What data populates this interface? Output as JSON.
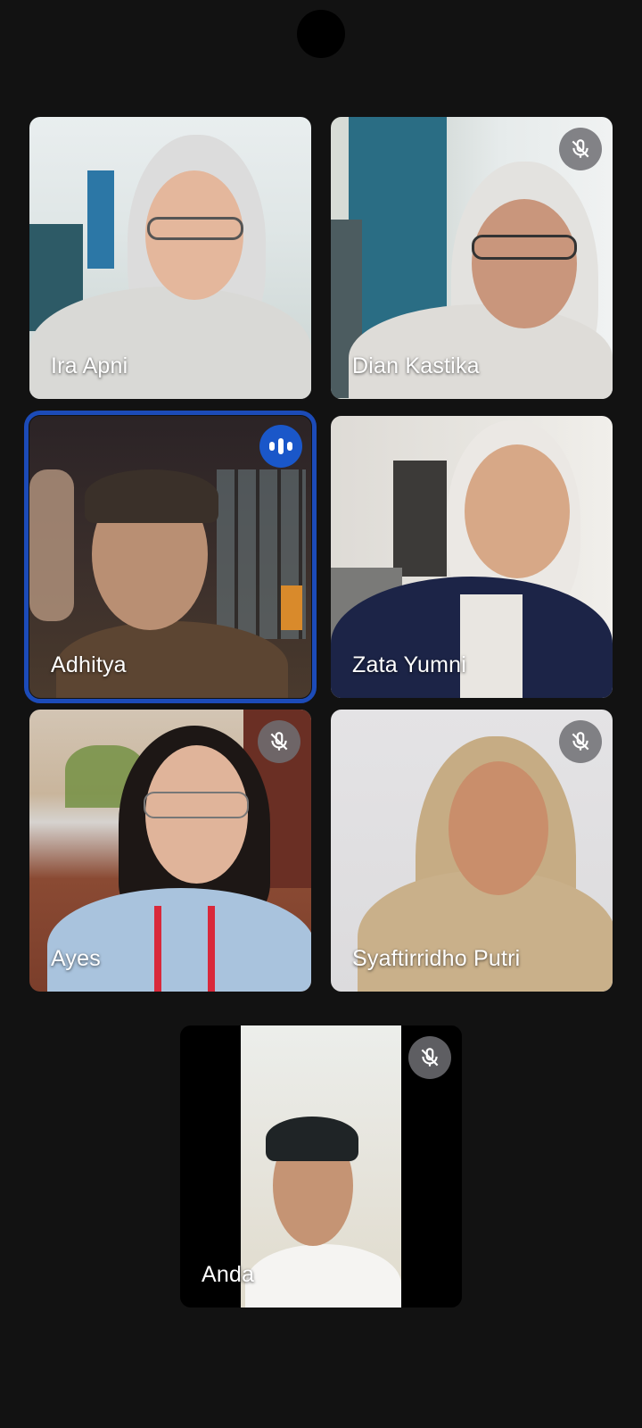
{
  "participants": [
    {
      "name": "Ira Apni",
      "muted": false,
      "speaking": false
    },
    {
      "name": "Dian Kastika",
      "muted": true,
      "speaking": false
    },
    {
      "name": "Adhitya",
      "muted": false,
      "speaking": true
    },
    {
      "name": "Zata Yumni",
      "muted": false,
      "speaking": false
    },
    {
      "name": "Ayes",
      "muted": true,
      "speaking": false
    },
    {
      "name": "Syaftirridho Putri",
      "muted": true,
      "speaking": false
    },
    {
      "name": "Anda",
      "muted": true,
      "speaking": false
    }
  ],
  "icons": {
    "muted": "mic-off-icon",
    "speaking": "audio-level-icon"
  },
  "colors": {
    "background": "#121212",
    "active_border": "#1c4bb8",
    "speaking_badge": "#1a57c9",
    "mute_badge": "#6e6e73"
  }
}
